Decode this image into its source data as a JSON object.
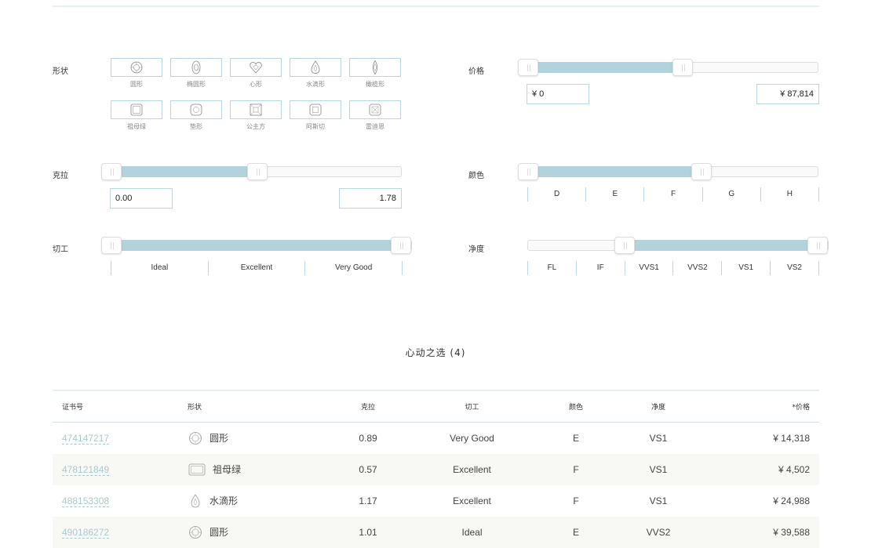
{
  "filters": {
    "shape": {
      "label": "形状",
      "items": [
        {
          "name": "圆形",
          "icon": "round-icon"
        },
        {
          "name": "椭圆形",
          "icon": "oval-icon"
        },
        {
          "name": "心形",
          "icon": "heart-icon"
        },
        {
          "name": "水滴形",
          "icon": "pear-icon"
        },
        {
          "name": "橄榄形",
          "icon": "marquise-icon"
        },
        {
          "name": "祖母绿",
          "icon": "emerald-icon"
        },
        {
          "name": "垫形",
          "icon": "cushion-icon"
        },
        {
          "name": "公主方",
          "icon": "princess-icon"
        },
        {
          "name": "阿斯切",
          "icon": "asscher-icon"
        },
        {
          "name": "雷迪恩",
          "icon": "radiant-icon"
        }
      ]
    },
    "carat": {
      "label": "克拉",
      "min": "0.00",
      "max": "1.78",
      "selected_fraction": [
        0,
        0.5
      ]
    },
    "cut": {
      "label": "切工",
      "options": [
        "Ideal",
        "Excellent",
        "Very Good"
      ],
      "selected_fraction": [
        0,
        1
      ]
    },
    "price": {
      "label": "价格",
      "min": "¥ 0",
      "max": "¥ 87,814",
      "selected_fraction": [
        0,
        0.52
      ]
    },
    "color": {
      "label": "颜色",
      "options": [
        "D",
        "E",
        "F",
        "G",
        "H"
      ],
      "selected_fraction": [
        0,
        0.6
      ]
    },
    "clarity": {
      "label": "净度",
      "options": [
        "FL",
        "IF",
        "VVS1",
        "VVS2",
        "VS1",
        "VS2"
      ],
      "selected_fraction": [
        0.33,
        1
      ]
    }
  },
  "results": {
    "title": "心动之选 (4)",
    "headers": {
      "cert": "证书号",
      "shape": "形状",
      "carat": "克拉",
      "cut": "切工",
      "color": "颜色",
      "clarity": "净度",
      "price": "*价格"
    },
    "rows": [
      {
        "cert": "474147217",
        "shape": "圆形",
        "shape_icon": "round-icon",
        "carat": "0.89",
        "cut": "Very Good",
        "color": "E",
        "clarity": "VS1",
        "price": "¥ 14,318"
      },
      {
        "cert": "478121849",
        "shape": "祖母绿",
        "shape_icon": "emerald-icon",
        "carat": "0.57",
        "cut": "Excellent",
        "color": "F",
        "clarity": "VS1",
        "price": "¥ 4,502"
      },
      {
        "cert": "488153308",
        "shape": "水滴形",
        "shape_icon": "pear-icon",
        "carat": "1.17",
        "cut": "Excellent",
        "color": "F",
        "clarity": "VS1",
        "price": "¥ 24,988"
      },
      {
        "cert": "490186272",
        "shape": "圆形",
        "shape_icon": "round-icon",
        "carat": "1.01",
        "cut": "Ideal",
        "color": "E",
        "clarity": "VVS2",
        "price": "¥ 39,588"
      }
    ]
  },
  "colors": {
    "accent": "#b3d3dc",
    "border": "#b9d7df",
    "link": "#a9c9d2"
  }
}
